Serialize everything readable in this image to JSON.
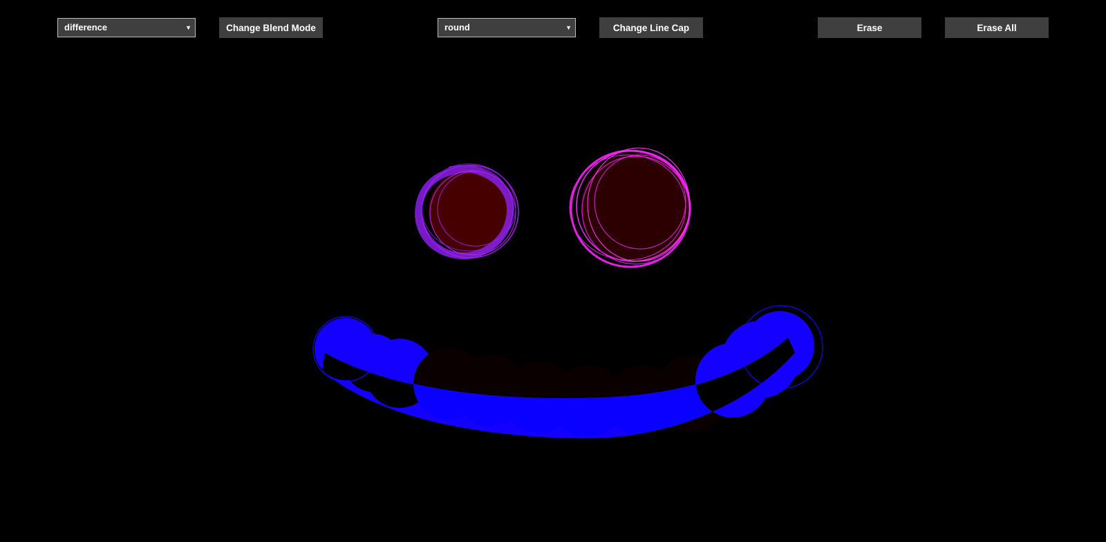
{
  "toolbar": {
    "blend_mode_select": {
      "value": "difference"
    },
    "change_blend_mode_label": "Change Blend Mode",
    "line_cap_select": {
      "value": "round"
    },
    "change_line_cap_label": "Change Line Cap",
    "erase_label": "Erase",
    "erase_all_label": "Erase All",
    "dropdown_icon": "caret-down-icon"
  },
  "drawing": {
    "background": "#000000",
    "colors": {
      "left_eye_stroke": "#8a1ee6",
      "left_eye_fill": "#470000",
      "right_eye_stroke": "#e61ee6",
      "right_eye_fill": "#2c0000",
      "mouth": "#1400ff",
      "mouth_dark": "#0a0000"
    }
  }
}
